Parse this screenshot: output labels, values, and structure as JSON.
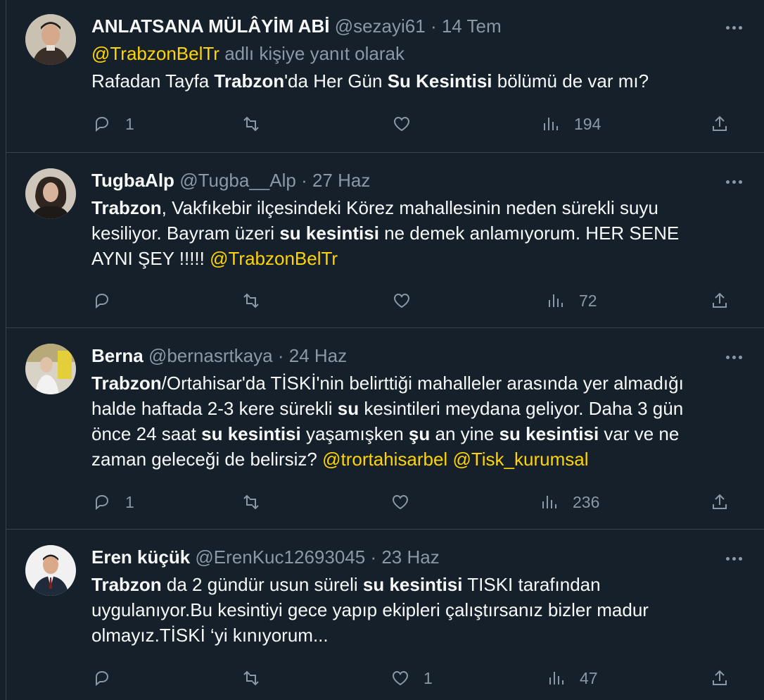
{
  "tweets": [
    {
      "name": "ANLATSANA MÜLÂYİM ABİ",
      "handle": "@sezayi61",
      "date": "· 14 Tem",
      "reply_to_mention": "@TrabzonBelTr",
      "reply_to_suffix": " adlı kişiye yanıt olarak",
      "text": [
        {
          "t": "Rafadan Tayfa ",
          "s": "n"
        },
        {
          "t": "Trabzon",
          "s": "b"
        },
        {
          "t": "'da Her Gün ",
          "s": "n"
        },
        {
          "t": "Su Kesintisi",
          "s": "b"
        },
        {
          "t": " bölümü de var mı?",
          "s": "n"
        }
      ],
      "replies": "1",
      "retweets": "",
      "likes": "",
      "views": "194",
      "avatar_colors": [
        "#c9c1b2",
        "#3a2e28"
      ]
    },
    {
      "name": "TugbaAlp",
      "handle": "@Tugba__Alp",
      "date": "· 27 Haz",
      "text": [
        {
          "t": "Trabzon",
          "s": "b"
        },
        {
          "t": ", Vakfıkebir ilçesindeki Körez mahallesinin neden sürekli suyu kesiliyor. Bayram üzeri ",
          "s": "n"
        },
        {
          "t": "su kesintisi",
          "s": "b"
        },
        {
          "t": " ne demek anlamıyorum. HER SENE AYNI ŞEY !!!!! ",
          "s": "n"
        },
        {
          "t": "@TrabzonBelTr",
          "s": "m"
        }
      ],
      "replies": "",
      "retweets": "",
      "likes": "",
      "views": "72",
      "avatar_colors": [
        "#cfc6bb",
        "#2f2520"
      ]
    },
    {
      "name": "Berna",
      "handle": "@bernasrtkaya",
      "date": "· 24 Haz",
      "text": [
        {
          "t": "Trabzon",
          "s": "b"
        },
        {
          "t": "/Ortahisar'da TİSKİ'nin belirttiği mahalleler arasında yer almadığı halde haftada 2-3 kere sürekli ",
          "s": "n"
        },
        {
          "t": "su",
          "s": "b"
        },
        {
          "t": " kesintileri meydana geliyor. Daha 3 gün önce 24 saat ",
          "s": "n"
        },
        {
          "t": "su kesintisi",
          "s": "b"
        },
        {
          "t": " yaşamışken ",
          "s": "n"
        },
        {
          "t": "şu",
          "s": "b"
        },
        {
          "t": " an yine ",
          "s": "n"
        },
        {
          "t": "su kesintisi",
          "s": "b"
        },
        {
          "t": " var ve ne zaman geleceği de belirsiz? ",
          "s": "n"
        },
        {
          "t": "@trortahisarbel",
          "s": "m"
        },
        {
          "t": " ",
          "s": "n"
        },
        {
          "t": "@Tisk_kurumsal",
          "s": "m"
        }
      ],
      "replies": "1",
      "retweets": "",
      "likes": "",
      "views": "236",
      "avatar_colors": [
        "#b7a97a",
        "#d9d2c7"
      ]
    },
    {
      "name": "Eren küçük",
      "handle": "@ErenKuc12693045",
      "date": "· 23 Haz",
      "text": [
        {
          "t": "Trabzon",
          "s": "b"
        },
        {
          "t": " da 2 gündür usun süreli ",
          "s": "n"
        },
        {
          "t": "su kesintisi",
          "s": "b"
        },
        {
          "t": " TISKI tarafından uygulanıyor.Bu kesintiyi gece yapıp ekipleri çalıştırsanız bizler madur olmayız.TİSKİ ‘yi kınıyorum...",
          "s": "n"
        }
      ],
      "replies": "",
      "retweets": "",
      "likes": "1",
      "views": "47",
      "avatar_colors": [
        "#f1f1f1",
        "#1f2a3a"
      ]
    }
  ],
  "icons": {
    "reply": "reply-icon",
    "retweet": "retweet-icon",
    "like": "heart-icon",
    "views": "views-icon",
    "share": "share-icon",
    "more": "more-icon"
  },
  "colors": {
    "background": "#15202b",
    "mention": "#ffd400",
    "secondary_text": "#8b98a5",
    "divider": "#38444d"
  }
}
